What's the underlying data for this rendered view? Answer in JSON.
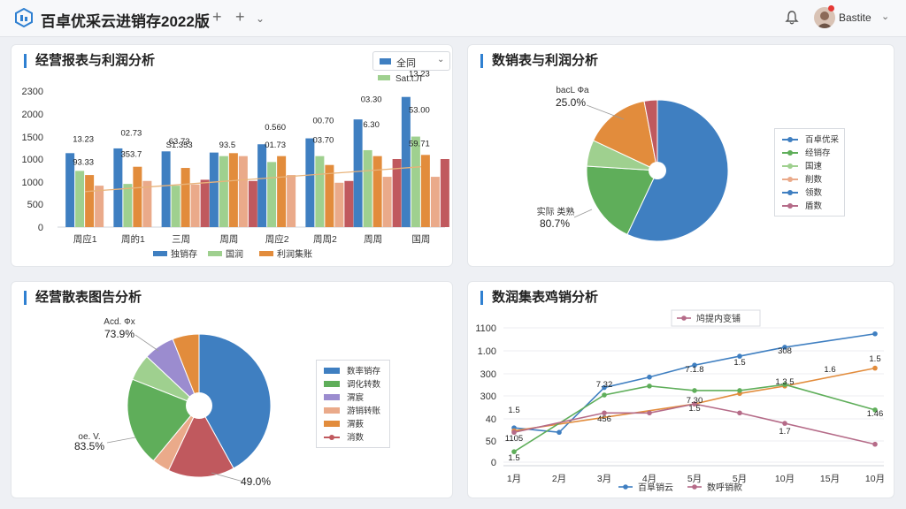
{
  "app": {
    "title": "百卓优采云进销存2022版",
    "user_name": "Bastite",
    "colors": {
      "blue": "#3f7fc1",
      "green": "#5fae5a",
      "orange": "#e28c3c",
      "red": "#c0595e",
      "light_green": "#9fd08f",
      "salmon": "#eaaa8a",
      "purple": "#9b8ccf",
      "pink": "#b56b88"
    }
  },
  "toolbar": {
    "add_icon": "plus-icon",
    "add2_icon": "plus-icon",
    "more_icon": "chevron-down-icon"
  },
  "panel1": {
    "title": "经营报表与利润分析",
    "select_label": "全同",
    "top_legend": "Sat.t.Л",
    "y_ticks": [
      "2300",
      "2000",
      "1500",
      "1000",
      "1000",
      "500",
      "0"
    ],
    "categories": [
      "周应1",
      "周的1",
      "三周",
      "周周",
      "周应2",
      "周周2",
      "周周",
      "国周"
    ],
    "legend": [
      "独销存",
      "国润",
      "利润集账"
    ],
    "chart_data": {
      "type": "bar",
      "categories": [
        "周应1",
        "周的1",
        "三周",
        "周周",
        "周应2",
        "周周2",
        "周周",
        "国周"
      ],
      "series": [
        {
          "name": "独销存",
          "values": [
            1250,
            1330,
            1280,
            1260,
            1400,
            1500,
            1820,
            2200
          ]
        },
        {
          "name": "国润",
          "values": [
            950,
            730,
            700,
            1200,
            1100,
            1200,
            1300,
            1530
          ]
        },
        {
          "name": "利润集账",
          "values": [
            880,
            1020,
            1000,
            1250,
            1200,
            1050,
            1200,
            1220
          ]
        },
        {
          "values": [
            700,
            780,
            720,
            1200,
            880,
            750,
            850,
            850
          ]
        },
        {
          "values": [
            null,
            null,
            800,
            780,
            null,
            780,
            1150,
            1150
          ]
        }
      ],
      "trend": [
        600,
        660,
        720,
        780,
        840,
        900,
        960,
        1020
      ],
      "data_labels": [
        {
          "text": "13.23",
          "ci": 0,
          "y": 1400
        },
        {
          "text": "93.33",
          "ci": 0,
          "y": 1010
        },
        {
          "text": "02.73",
          "ci": 1,
          "y": 1500
        },
        {
          "text": "353.7",
          "ci": 1,
          "y": 1140
        },
        {
          "text": "63.73",
          "ci": 2,
          "y": 1360
        },
        {
          "text": "S1.353",
          "ci": 2,
          "y": 1300
        },
        {
          "text": "93.5",
          "ci": 3,
          "y": 1300
        },
        {
          "text": "0.560",
          "ci": 4,
          "y": 1600
        },
        {
          "text": "01.73",
          "ci": 4,
          "y": 1300
        },
        {
          "text": "00.70",
          "ci": 5,
          "y": 1710
        },
        {
          "text": "03.70",
          "ci": 5,
          "y": 1380
        },
        {
          "text": "03.30",
          "ci": 6,
          "y": 2070
        },
        {
          "text": "6.30",
          "ci": 6,
          "y": 1640
        },
        {
          "text": "53.00",
          "ci": 7,
          "y": 1890
        },
        {
          "text": "13.23",
          "ci": 7,
          "y": 2500
        },
        {
          "text": "59.71",
          "ci": 7,
          "y": 1320
        }
      ],
      "ylim": [
        0,
        2300
      ]
    }
  },
  "panel2": {
    "title": "数销表与利润分析",
    "label_top": "bacL Фа",
    "pct_top": "25.0%",
    "label_left": "实际 类熟",
    "pct_left": "80.7%",
    "legend": [
      "百卓优采",
      "经销存",
      "国速",
      "削数",
      "领数",
      "盾数"
    ],
    "chart_data": {
      "type": "pie",
      "labels": [
        "百卓优采",
        "经销存",
        "国速",
        "削数",
        "领数",
        "盾数"
      ],
      "values": [
        57,
        19,
        6,
        15,
        0,
        3
      ]
    }
  },
  "panel3": {
    "title": "经营散表图告分析",
    "label_top": "Acd. Фx",
    "pct_top": "73.9%",
    "label_left": "oe. V.",
    "pct_left": "83.5%",
    "pct_bottom": "49.0%",
    "legend": [
      "数率销存",
      "调化转数",
      "渭宸",
      "游销转账",
      "渭薮",
      "消数"
    ],
    "chart_data": {
      "type": "pie",
      "labels": [
        "数率销存",
        "游销转账",
        "调化转数",
        "渭宸",
        "渭薮",
        "消数"
      ],
      "values": [
        42,
        15,
        4,
        20,
        6,
        7,
        6
      ]
    }
  },
  "panel4": {
    "title": "数润集表鸡销分析",
    "legend_top": "鸠提内变铺",
    "legend_bottom": [
      "百阜销云",
      "数呼销款"
    ],
    "y_ticks": [
      "1100",
      "1.00",
      "300",
      "300",
      "40",
      "50",
      "0"
    ],
    "x_ticks": [
      "1月",
      "2月",
      "3月",
      "4月",
      "5月",
      "5月",
      "10月",
      "15月",
      "10月"
    ],
    "chart_data": {
      "type": "line",
      "x": [
        "1月",
        "2月",
        "3月",
        "4月",
        "5月",
        "5月",
        "10月",
        "15月",
        "10月"
      ],
      "series": [
        {
          "name": "百阜销云",
          "values": [
            null,
            5.0,
            8.0,
            8.7,
            9.5,
            10.1,
            10.7,
            null,
            11.6
          ]
        },
        {
          "values": [
            null,
            null,
            null,
            null,
            6.9,
            7.6,
            8.1,
            null,
            9.3
          ]
        },
        {
          "values": [
            null,
            null,
            7.5,
            8.1,
            7.8,
            7.8,
            8.2,
            null,
            6.5
          ]
        },
        {
          "name": "数呼销款",
          "values": [
            null,
            null,
            6.3,
            6.3,
            6.9,
            6.3,
            5.6,
            null,
            4.2
          ]
        }
      ],
      "data_labels": [
        "1.5",
        "1105",
        "1.5",
        "7.32",
        "456",
        "7.1.8",
        "7.30",
        "1.5",
        "1.5",
        "308",
        "1.6",
        "1.5",
        "1.3.5",
        "1.7",
        "1.46"
      ]
    }
  }
}
